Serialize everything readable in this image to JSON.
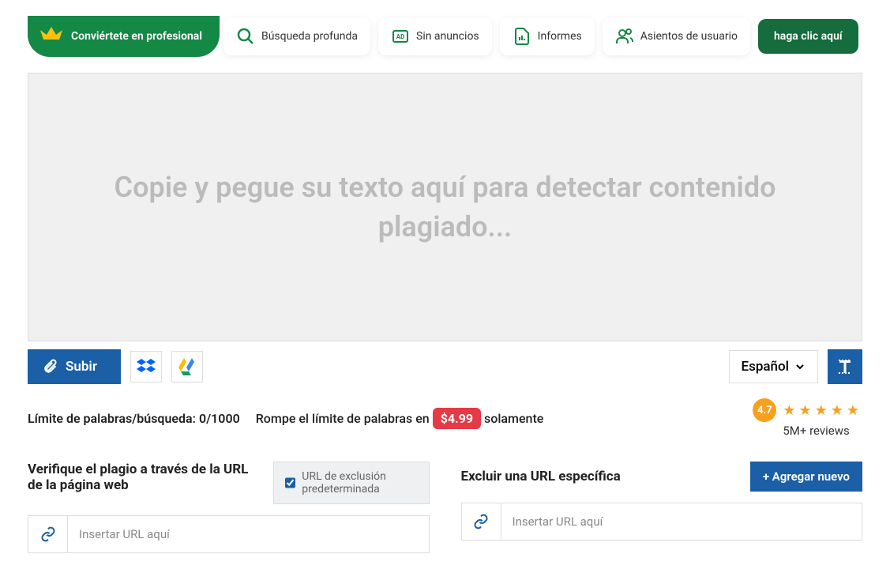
{
  "banner": {
    "label": "Conviértete en profesional"
  },
  "features": {
    "deep_search": "Búsqueda profunda",
    "no_ads": "Sin anuncios",
    "reports": "Informes",
    "user_seats": "Asientos de usuario"
  },
  "cta": "haga clic aquí",
  "textarea": {
    "placeholder": "Copie y pegue su texto aquí para detectar contenido plagiado..."
  },
  "upload_label": "Subir",
  "language": {
    "selected": "Español"
  },
  "limit": {
    "label": "Límite de palabras/búsqueda: 0/1000"
  },
  "break_limit": {
    "prefix": "Rompe el límite de palabras en",
    "price": "$4.99",
    "suffix": "solamente"
  },
  "rating": {
    "value": "4.7",
    "reviews": "5M+ reviews"
  },
  "url_verify": {
    "title": "Verifique el plagio a través de la URL de la página web",
    "default_exclusion": "URL de exclusión predeterminada",
    "placeholder": "Insertar URL aquí"
  },
  "url_exclude": {
    "title": "Excluir una URL específica",
    "add_new": "+ Agregar nuevo",
    "placeholder": "Insertar URL aquí"
  }
}
